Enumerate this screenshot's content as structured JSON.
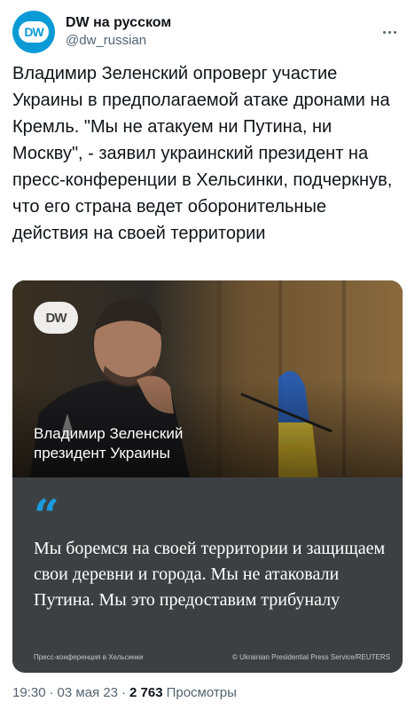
{
  "account": {
    "display_name": "DW на русском",
    "handle": "@dw_russian",
    "avatar_text": "DW"
  },
  "tweet": {
    "text": "Владимир Зеленский опроверг участие Украины в предполагаемой атаке дронами на Кремль. \"Мы не атакуем ни Путина, ни Москву\", - заявил украинский президент на пресс-конференции в Хельсинки, подчеркнув, что его страна ведет оборонительные действия на своей территории"
  },
  "media": {
    "logo_text": "DW",
    "caption_name": "Владимир Зеленский",
    "caption_role": "президент Украины",
    "quote_mark": "“",
    "quote": "Мы боремся на своей территории и защищаем свои деревни и города. Мы не атаковали Путина. Мы это предоставим трибуналу",
    "credit_left": "Пресс-конференция в Хельсинки",
    "credit_right": "© Ukrainian Presidential Press Service/REUTERS"
  },
  "meta": {
    "time": "19:30",
    "separator": "·",
    "date": "03 мая 23",
    "views_count": "2 763",
    "views_label": "Просмотры"
  },
  "colors": {
    "accent": "#1a9be0",
    "dw_blue": "#0a9bd6",
    "quote_panel": "#3d4043"
  }
}
